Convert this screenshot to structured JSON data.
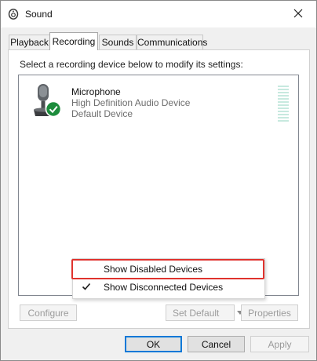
{
  "window": {
    "title": "Sound"
  },
  "tabs": [
    {
      "label": "Playback"
    },
    {
      "label": "Recording"
    },
    {
      "label": "Sounds"
    },
    {
      "label": "Communications"
    }
  ],
  "panel": {
    "instruction": "Select a recording device below to modify its settings:"
  },
  "device": {
    "name": "Microphone",
    "driver": "High Definition Audio Device",
    "status": "Default Device"
  },
  "context_menu": {
    "items": [
      {
        "label": "Show Disabled Devices",
        "checked": false
      },
      {
        "label": "Show Disconnected Devices",
        "checked": true
      }
    ]
  },
  "panel_buttons": {
    "configure": "Configure",
    "set_default": "Set Default",
    "properties": "Properties"
  },
  "dialog_buttons": {
    "ok": "OK",
    "cancel": "Cancel",
    "apply": "Apply"
  },
  "colors": {
    "accent": "#0078d7",
    "highlight_border": "#e0332e",
    "default_badge": "#1c8c3c"
  }
}
